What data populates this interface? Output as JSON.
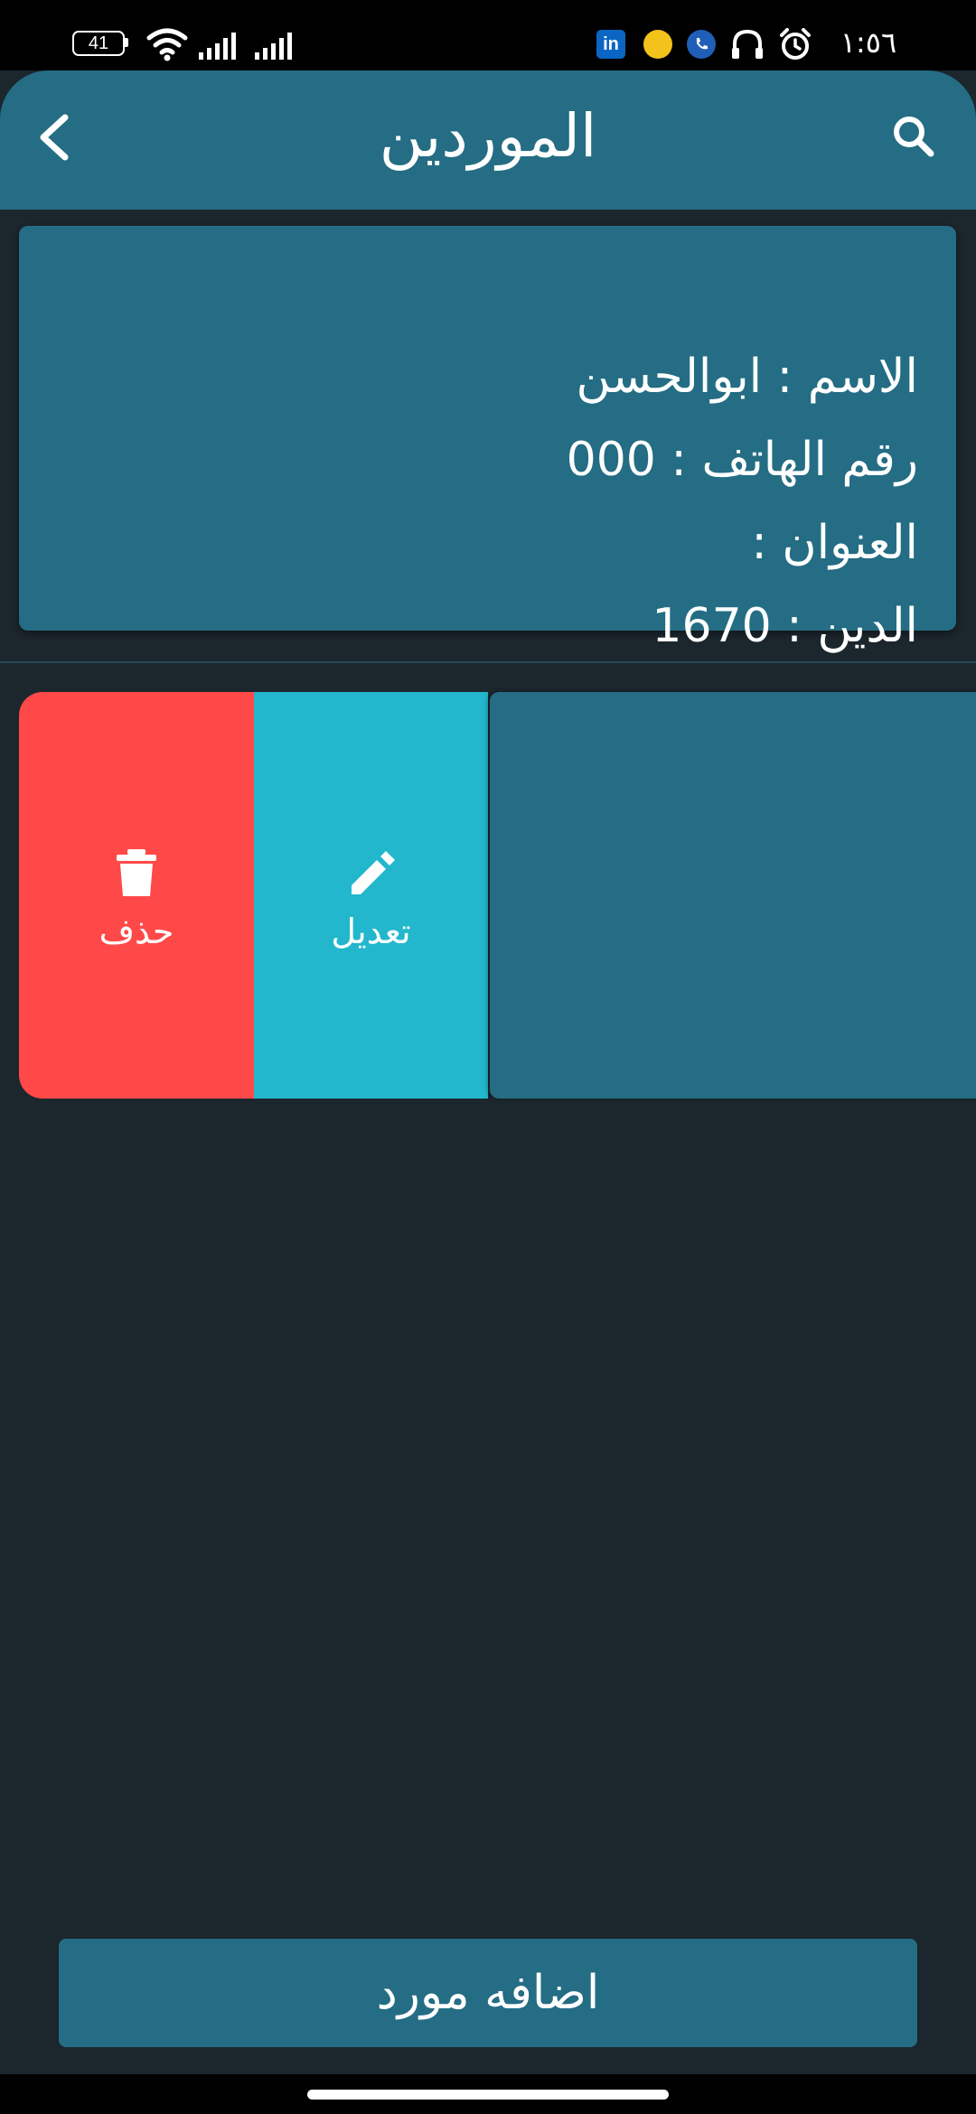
{
  "status_bar": {
    "battery": "41",
    "time": "١:٥٦ ص",
    "notification_icons": [
      "linkedin-icon",
      "emoji-icon",
      "phone-icon",
      "headphones-icon",
      "alarm-icon"
    ]
  },
  "header": {
    "title": "الموردين"
  },
  "supplier_card": {
    "name_line": "الاسم : ابوالحسن",
    "phone_line": "رقم الهاتف : 000",
    "address_line": "العنوان :",
    "debt_line": "الدين : 1670"
  },
  "swipe_actions": {
    "delete_label": "حذف",
    "edit_label": "تعديل"
  },
  "footer": {
    "add_button_label": "اضافه مورد"
  },
  "colors": {
    "primary": "#246d84",
    "background": "#1c262d",
    "delete": "#ff4949",
    "edit": "#22b7cc"
  }
}
